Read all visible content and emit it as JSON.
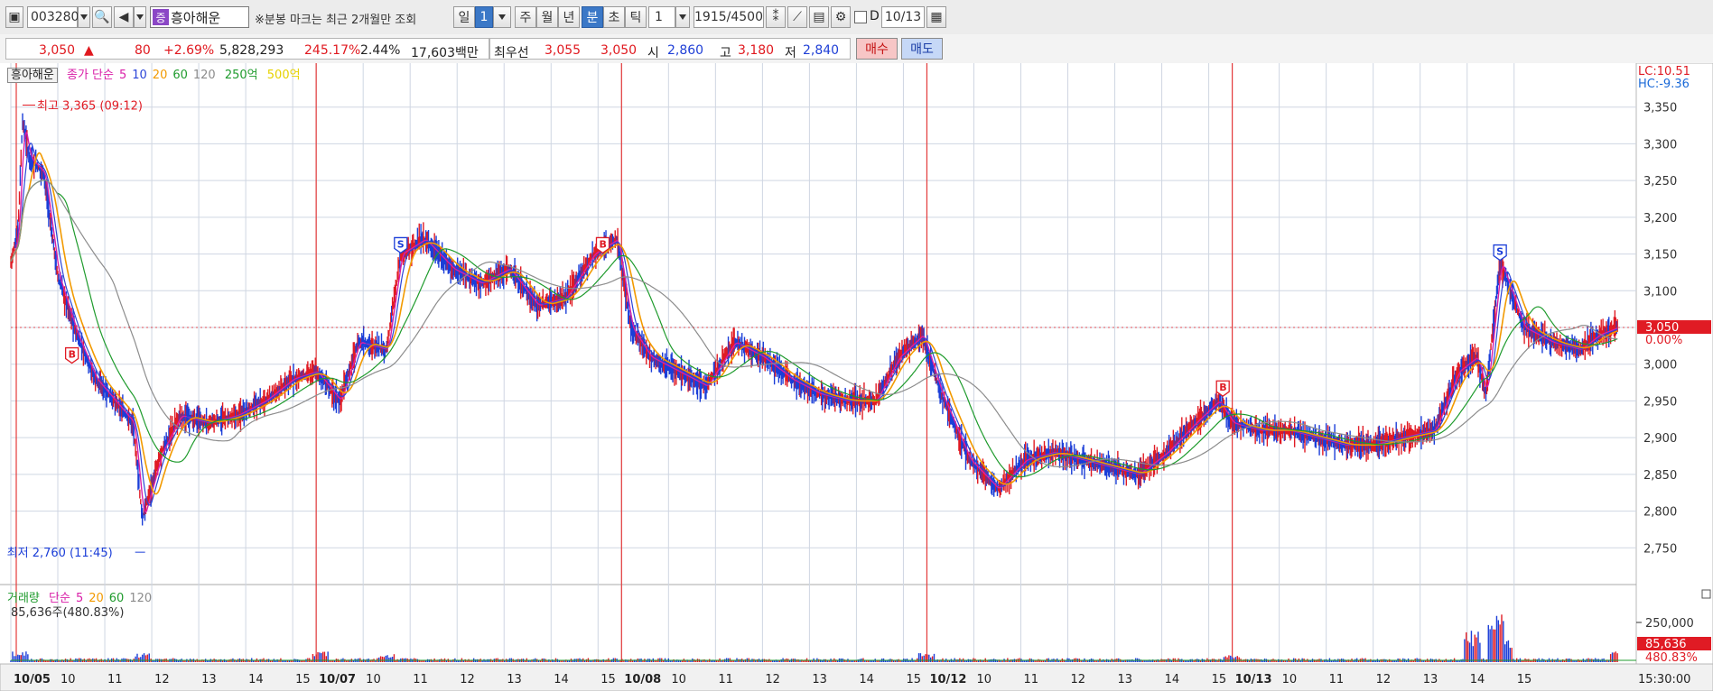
{
  "toolbar": {
    "stock_code": "003280",
    "stock_type_badge": "증",
    "stock_name": "흥아해운",
    "notice": "※분봉 마크는 최근 2개월만 조회",
    "period_buttons": [
      "일",
      "1",
      "주",
      "월",
      "년",
      "분",
      "초",
      "틱"
    ],
    "selected_period": "분",
    "interval_value": "1",
    "count": "1915/4500",
    "d_label": "D",
    "date_value": "10/13"
  },
  "quote": {
    "price": "3,050",
    "arrow": "▲",
    "change": "80",
    "change_pct": "+2.69%",
    "volume": "5,828,293",
    "volume_ratio": "245.17%",
    "turnover": "2.44%",
    "amount": "17,603백만",
    "best_label": "최우선",
    "best_ask": "3,055",
    "best_bid": "3,050",
    "open_label": "시",
    "open": "2,860",
    "high_label": "고",
    "high": "3,180",
    "low_label": "저",
    "low": "2,840",
    "buy_label": "매수",
    "sell_label": "매도"
  },
  "legend": {
    "stock_name": "흥아해운",
    "price_label": "종가 단순",
    "ma": [
      "5",
      "10",
      "20",
      "60",
      "120"
    ],
    "amount_250": "250억",
    "amount_500": "500억"
  },
  "colors": {
    "ma5": "#d91fa8",
    "ma10": "#2b45d8",
    "ma20": "#f29a00",
    "ma60": "#1f9b2d",
    "ma120": "#8c8c8c",
    "up": "#e01b24",
    "down": "#1b3ed8",
    "grid": "#cfd6e2",
    "session": "#e43a3a"
  },
  "annotations": {
    "max_label": "최고 3,365 (09:12)",
    "min_label": "최저 2,760 (11:45)",
    "lc": "LC:10.51",
    "hc": "HC:-9.36",
    "current_price_tag": "3,050",
    "current_pct_tag": "0.00%"
  },
  "volume_legend": {
    "label": "거래량",
    "ma_label": "단순",
    "ma": [
      "5",
      "20",
      "60",
      "120"
    ],
    "last_volume": "85,636주(480.83%)",
    "y_tick": "250,000",
    "tag_value": "85,636",
    "tag_pct": "480.83%"
  },
  "x_axis": {
    "labels": [
      {
        "t": "10/05",
        "b": true
      },
      {
        "t": "10"
      },
      {
        "t": "11"
      },
      {
        "t": "12"
      },
      {
        "t": "13"
      },
      {
        "t": "14"
      },
      {
        "t": "15"
      },
      {
        "t": "10/07",
        "b": true
      },
      {
        "t": "10"
      },
      {
        "t": "11"
      },
      {
        "t": "12"
      },
      {
        "t": "13"
      },
      {
        "t": "14"
      },
      {
        "t": "15"
      },
      {
        "t": "10/08",
        "b": true
      },
      {
        "t": "10"
      },
      {
        "t": "11"
      },
      {
        "t": "12"
      },
      {
        "t": "13"
      },
      {
        "t": "14"
      },
      {
        "t": "15"
      },
      {
        "t": "10/12",
        "b": true
      },
      {
        "t": "10"
      },
      {
        "t": "11"
      },
      {
        "t": "12"
      },
      {
        "t": "13"
      },
      {
        "t": "14"
      },
      {
        "t": "15"
      },
      {
        "t": "10/13",
        "b": true
      },
      {
        "t": "10"
      },
      {
        "t": "11"
      },
      {
        "t": "12"
      },
      {
        "t": "13"
      },
      {
        "t": "14"
      },
      {
        "t": "15"
      }
    ],
    "last_time": "15:30:00"
  },
  "chart_data": {
    "type": "candlestick",
    "x_unit": "trading hour slot (0 = 10/05 09:00, 6.5 per session)",
    "ylim": [
      2700,
      3400
    ],
    "y_ticks": [
      2750,
      2800,
      2850,
      2900,
      2950,
      3000,
      3050,
      3100,
      3150,
      3200,
      3250,
      3300,
      3350
    ],
    "session_boundaries": [
      6.5,
      13,
      19.5,
      26
    ],
    "price_path": [
      [
        0,
        3140
      ],
      [
        0.15,
        3180
      ],
      [
        0.25,
        3330
      ],
      [
        0.4,
        3280
      ],
      [
        0.7,
        3260
      ],
      [
        1.0,
        3120
      ],
      [
        1.4,
        3040
      ],
      [
        1.8,
        2980
      ],
      [
        2.2,
        2950
      ],
      [
        2.6,
        2920
      ],
      [
        2.8,
        2790
      ],
      [
        3.2,
        2880
      ],
      [
        3.6,
        2930
      ],
      [
        4.2,
        2920
      ],
      [
        4.8,
        2930
      ],
      [
        5.4,
        2950
      ],
      [
        6.0,
        2980
      ],
      [
        6.5,
        2990
      ],
      [
        7.0,
        2950
      ],
      [
        7.4,
        3030
      ],
      [
        8.0,
        3020
      ],
      [
        8.3,
        3150
      ],
      [
        8.8,
        3170
      ],
      [
        9.4,
        3130
      ],
      [
        10.0,
        3110
      ],
      [
        10.6,
        3130
      ],
      [
        11.2,
        3080
      ],
      [
        11.8,
        3090
      ],
      [
        12.4,
        3150
      ],
      [
        12.9,
        3170
      ],
      [
        13.2,
        3050
      ],
      [
        13.6,
        3010
      ],
      [
        14.2,
        2990
      ],
      [
        14.8,
        2970
      ],
      [
        15.4,
        3030
      ],
      [
        16.0,
        3010
      ],
      [
        16.6,
        2980
      ],
      [
        17.2,
        2960
      ],
      [
        17.8,
        2950
      ],
      [
        18.4,
        2950
      ],
      [
        18.9,
        3010
      ],
      [
        19.4,
        3040
      ],
      [
        19.8,
        2960
      ],
      [
        20.4,
        2870
      ],
      [
        21.0,
        2830
      ],
      [
        21.6,
        2870
      ],
      [
        22.2,
        2880
      ],
      [
        22.8,
        2870
      ],
      [
        23.4,
        2860
      ],
      [
        24.0,
        2850
      ],
      [
        24.6,
        2880
      ],
      [
        25.2,
        2920
      ],
      [
        25.7,
        2950
      ],
      [
        26.0,
        2920
      ],
      [
        26.6,
        2910
      ],
      [
        27.2,
        2910
      ],
      [
        27.8,
        2900
      ],
      [
        28.4,
        2890
      ],
      [
        29.0,
        2890
      ],
      [
        29.6,
        2900
      ],
      [
        30.3,
        2910
      ],
      [
        30.8,
        2990
      ],
      [
        31.2,
        3010
      ],
      [
        31.4,
        2960
      ],
      [
        31.7,
        3140
      ],
      [
        32.2,
        3050
      ],
      [
        32.8,
        3030
      ],
      [
        33.4,
        3020
      ],
      [
        33.8,
        3040
      ],
      [
        34.2,
        3050
      ]
    ],
    "high": {
      "x": 0.25,
      "value": 3365,
      "time": "09:12"
    },
    "low": {
      "x": 2.8,
      "value": 2760,
      "time": "11:45"
    },
    "buy_sell_marks": [
      {
        "x": 1.3,
        "price": 3010,
        "mark": "B"
      },
      {
        "x": 8.3,
        "price": 3160,
        "mark": "S"
      },
      {
        "x": 12.6,
        "price": 3160,
        "mark": "B"
      },
      {
        "x": 25.8,
        "price": 2965,
        "mark": "B"
      },
      {
        "x": 31.7,
        "price": 3150,
        "mark": "S"
      }
    ],
    "volume_peaks": [
      [
        0.2,
        12
      ],
      [
        2.8,
        10
      ],
      [
        6.6,
        12
      ],
      [
        8.0,
        9
      ],
      [
        19.5,
        10
      ],
      [
        26.0,
        8
      ],
      [
        31.1,
        35
      ],
      [
        31.6,
        55
      ],
      [
        31.8,
        25
      ],
      [
        34.2,
        14
      ]
    ]
  }
}
